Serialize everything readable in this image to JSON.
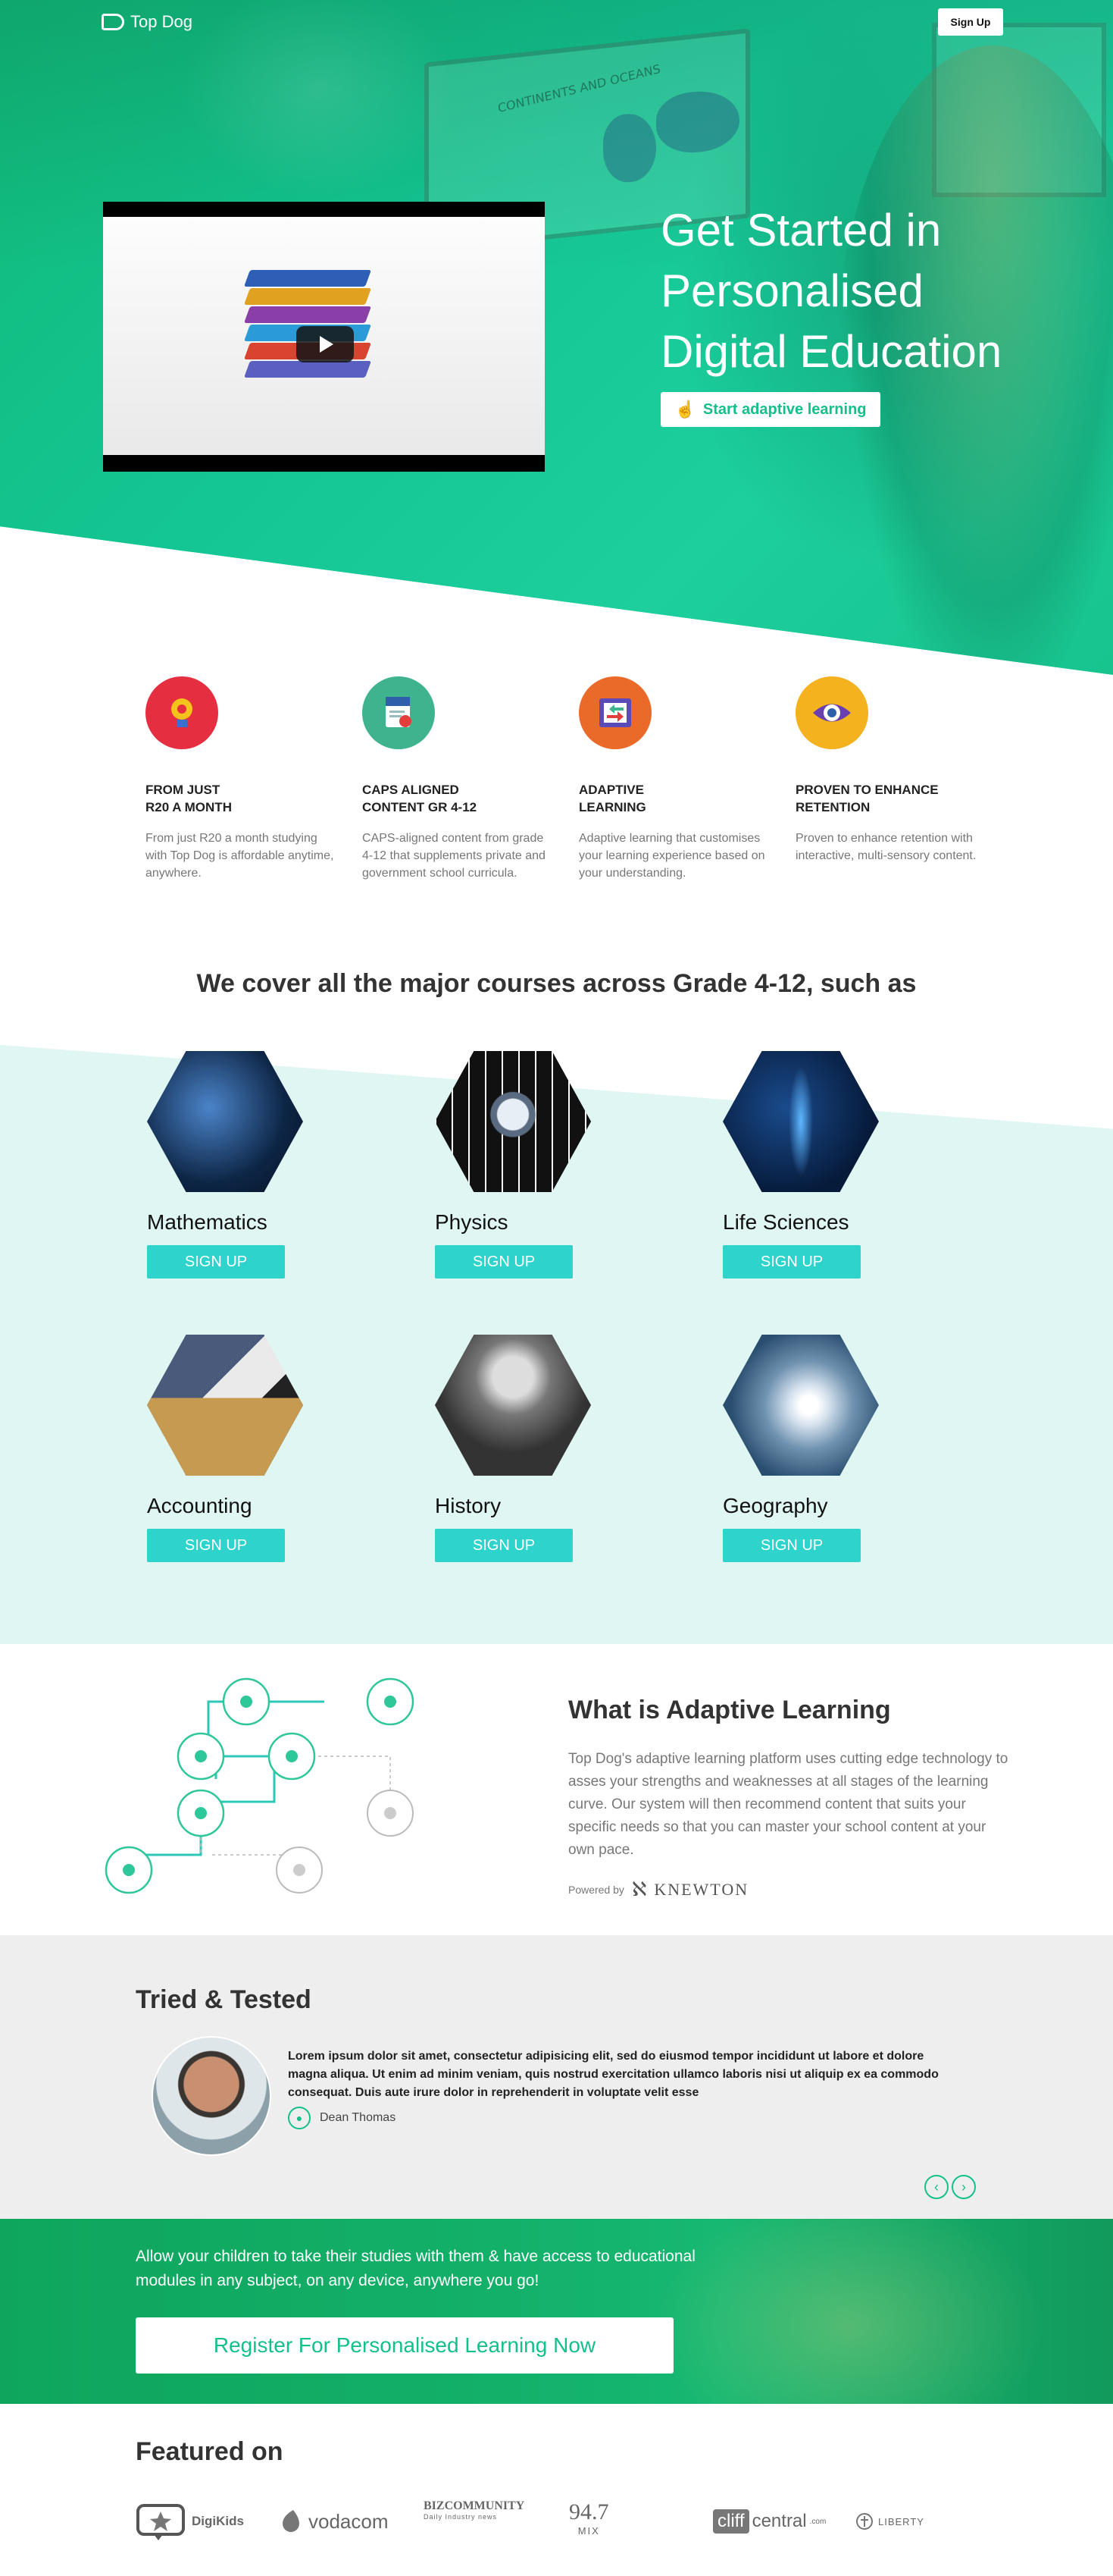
{
  "header": {
    "brand": "Top Dog",
    "signup_label": "Sign Up"
  },
  "hero": {
    "title": "Get Started in Personalised Digital Education",
    "cta_label": "Start adaptive learning",
    "map_caption": "CONTINENTS AND OCEANS"
  },
  "features": [
    {
      "icon": "lightbulb-icon",
      "title": "FROM JUST\nR20 A MONTH",
      "text": "From just R20 a month studying with Top Dog is affordable anytime, anywhere.",
      "color": "#e52e3f"
    },
    {
      "icon": "certificate-icon",
      "title": "CAPS ALIGNED\nCONTENT GR 4-12",
      "text": "CAPS-aligned content from grade 4-12 that supplements private and government school curricula.",
      "color": "#3fb38e"
    },
    {
      "icon": "adaptive-arrows-icon",
      "title": "ADAPTIVE\nLEARNING",
      "text": "Adaptive learning that customises your learning experience based on your understanding.",
      "color": "#ea6a2a"
    },
    {
      "icon": "eye-icon",
      "title": "PROVEN TO ENHANCE\nRETENTION",
      "text": "Proven to enhance retention with interactive, multi-sensory content.",
      "color": "#f4b21f"
    }
  ],
  "courses": {
    "heading": "We cover all the major courses across Grade 4-12, such as",
    "button_label": "SIGN UP",
    "items": [
      {
        "name": "Mathematics"
      },
      {
        "name": "Physics"
      },
      {
        "name": "Life Sciences"
      },
      {
        "name": "Accounting"
      },
      {
        "name": "History"
      },
      {
        "name": "Geography"
      }
    ]
  },
  "adaptive": {
    "title": "What is Adaptive Learning",
    "text": "Top Dog's adaptive learning platform uses cutting edge technology to asses your strengths and weaknesses at all stages of the learning curve. Our system will then recommend content that suits your specific needs so that you can master your school content at your own pace.",
    "powered_label": "Powered by",
    "powered_brand": "KNEWTON"
  },
  "testimonial": {
    "title": "Tried & Tested",
    "quote": "Lorem ipsum dolor sit amet, consectetur adipisicing elit, sed do eiusmod tempor incididunt ut labore et dolore magna aliqua. Ut enim ad minim veniam, quis nostrud exercitation ullamco laboris nisi ut aliquip ex ea commodo consequat. Duis aute irure dolor in reprehenderit in voluptate velit esse",
    "author": "Dean Thomas"
  },
  "band": {
    "text": "Allow your children to take their studies with them & have access to educational modules in any subject, on any device, anywhere you go!",
    "button_label": "Register For Personalised Learning Now"
  },
  "featured": {
    "title": "Featured on",
    "logos": [
      {
        "name": "DigiKids"
      },
      {
        "name": "vodacom"
      },
      {
        "name": "BIZCOMMUNITY",
        "sub": "Daily Industry news"
      },
      {
        "name": "94.7",
        "sub": "MIX"
      },
      {
        "name": "cliff",
        "name2": "central",
        "sub": ".com"
      },
      {
        "name": "LIBERTY"
      }
    ]
  },
  "colors": {
    "brand_green": "#14c08a",
    "course_button": "#2ed3cc",
    "courses_bg": "#e0f6f3"
  }
}
